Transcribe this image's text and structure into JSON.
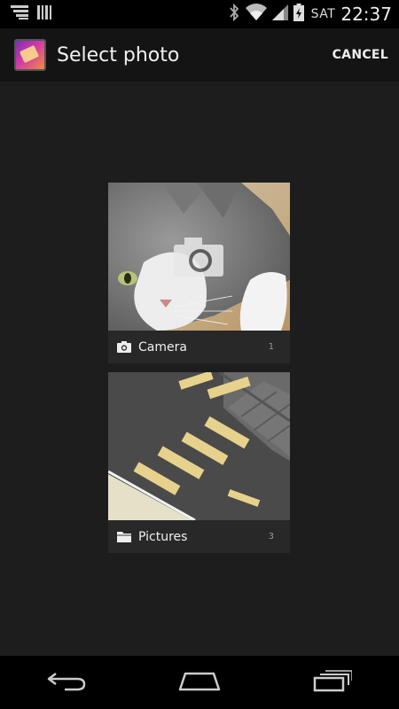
{
  "status_bar": {
    "day": "SAT",
    "time": "22:37",
    "icons": [
      "notification-icon",
      "barcode-icon",
      "bluetooth-icon",
      "wifi-icon",
      "signal-icon",
      "battery-charging-icon"
    ]
  },
  "action_bar": {
    "title": "Select photo",
    "cancel_label": "CANCEL"
  },
  "albums": [
    {
      "label": "Camera",
      "count": "1",
      "icon": "camera-icon"
    },
    {
      "label": "Pictures",
      "count": "3",
      "icon": "folder-icon"
    }
  ],
  "nav_bar": {
    "buttons": [
      "back-icon",
      "home-icon",
      "recent-apps-icon"
    ]
  },
  "colors": {
    "background": "#1d1d1d",
    "action_bar": "#141414",
    "status_bar": "#000000",
    "caption": "#282828"
  }
}
